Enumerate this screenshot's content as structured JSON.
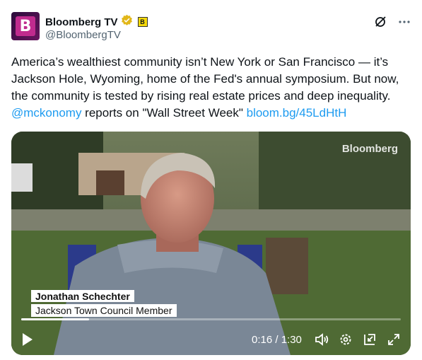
{
  "author": {
    "display_name": "Bloomberg TV",
    "handle": "@BloombergTV",
    "avatar_letter": "B",
    "affiliation_badge": "B"
  },
  "tweet": {
    "text_part1": "America’s wealthiest community isn’t New York or San Francisco — it’s Jackson Hole, Wyoming, home of the Fed's annual symposium. But now, the community is tested by rising real estate prices and deep inequality. ",
    "mention": "@mckonomy",
    "text_part2": " reports on \"Wall Street Week\" ",
    "link": "bloom.bg/45LdHtH"
  },
  "video": {
    "watermark": "Bloomberg",
    "lower_third_name": "Jonathan Schechter",
    "lower_third_title": "Jackson Town Council Member",
    "time_display": "0:16 / 1:30",
    "progress_fraction": 0.178
  },
  "icons": {
    "grok": "grok-icon",
    "more": "more-icon",
    "play": "play-icon",
    "volume": "volume-icon",
    "settings": "settings-icon",
    "pip": "picture-in-picture-icon",
    "fullscreen": "fullscreen-icon"
  },
  "colors": {
    "link": "#1d9bf0",
    "verified_gold": "#e2b719",
    "text": "#0f1419",
    "muted": "#536471"
  }
}
